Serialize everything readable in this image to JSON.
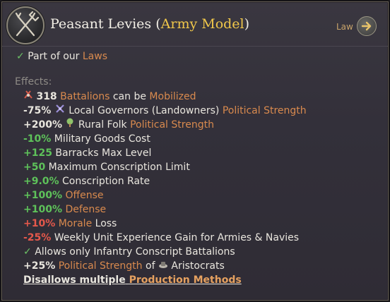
{
  "header": {
    "title_main": "Peasant Levies",
    "title_paren_open": "(",
    "title_highlight": "Army Model",
    "title_paren_close": ")",
    "law_tag": "Law",
    "emblem_icon": "pitchfork-icon",
    "law_button_icon": "arrow-right-icon"
  },
  "status": {
    "check_icon": "checkmark-icon",
    "text": "Part of our",
    "link": "Laws"
  },
  "effects_label": "Effects:",
  "effects": {
    "battalions": {
      "value": "318",
      "link": "Battalions",
      "mid": "can be",
      "link2": "Mobilized",
      "icon": "battalion-icon"
    },
    "governors": {
      "value": "-75%",
      "text": "Local Governors (Landowners)",
      "link": "Political Strength",
      "icon": "governor-icon"
    },
    "rural": {
      "value": "+200%",
      "text": "Rural Folk",
      "link": "Political Strength",
      "icon": "tree-icon"
    },
    "military_goods": {
      "value": "-10%",
      "text": "Military Goods Cost"
    },
    "barracks": {
      "value": "+125",
      "text": "Barracks Max Level"
    },
    "conscription_limit": {
      "value": "+50",
      "text": "Maximum Conscription Limit"
    },
    "conscription_rate": {
      "value": "+9.0%",
      "text": "Conscription Rate"
    },
    "offense": {
      "value": "+100%",
      "link": "Offense"
    },
    "defense": {
      "value": "+100%",
      "link": "Defense"
    },
    "morale": {
      "value": "+10%",
      "link": "Morale",
      "text": "Loss"
    },
    "experience": {
      "value": "-25%",
      "text": "Weekly Unit Experience Gain for Armies & Navies"
    },
    "infantry": {
      "text": "Allows only Infantry Conscript Battalions",
      "icon": "checkmark-icon"
    },
    "aristocrats": {
      "value": "+25%",
      "link": "Political Strength",
      "mid": "of",
      "text": "Aristocrats",
      "icon": "aristocrat-icon"
    },
    "disallow": {
      "text": "Disallows multiple",
      "link": "Production Methods"
    }
  }
}
